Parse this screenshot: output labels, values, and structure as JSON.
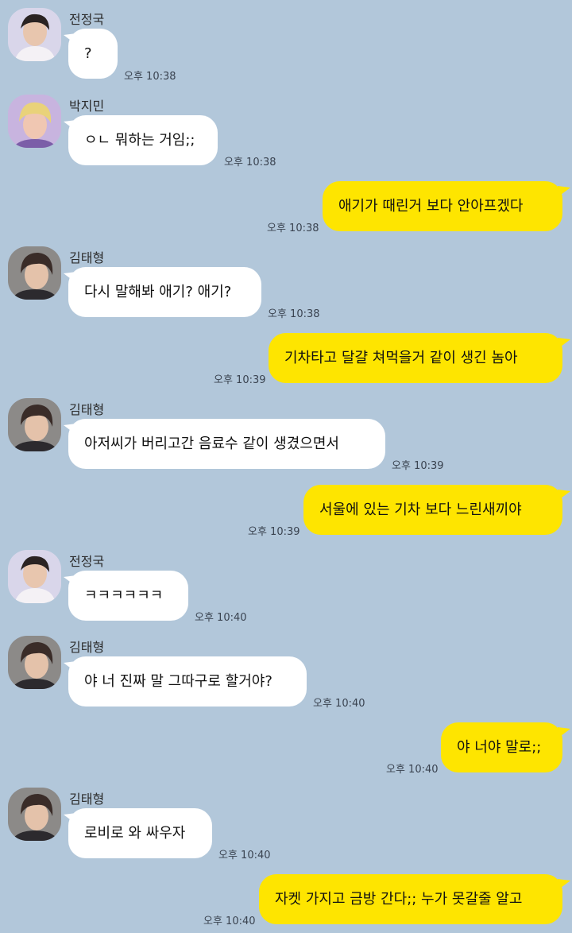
{
  "colors": {
    "background": "#b2c7da",
    "incoming_bubble": "#ffffff",
    "outgoing_bubble": "#fee500"
  },
  "messages": [
    {
      "type": "in",
      "sender": "전정국",
      "text": "?",
      "time": "오후 10:38",
      "avatar": "jungkook-avatar"
    },
    {
      "type": "in",
      "sender": "박지민",
      "text": "ㅇㄴ 뭐하는 거임;;",
      "time": "오후 10:38",
      "avatar": "jimin-avatar"
    },
    {
      "type": "out",
      "text": "애기가 때린거 보다 안아프겠다",
      "time": "오후 10:38"
    },
    {
      "type": "in",
      "sender": "김태형",
      "text": "다시 말해봐 애기? 애기?",
      "time": "오후 10:38",
      "avatar": "taehyung-avatar"
    },
    {
      "type": "out",
      "text": "기차타고 달걀 쳐먹을거 같이 생긴 놈아",
      "time": "오후 10:39"
    },
    {
      "type": "in",
      "sender": "김태형",
      "text": "아저씨가 버리고간 음료수 같이 생겼으면서",
      "time": "오후 10:39",
      "avatar": "taehyung-avatar"
    },
    {
      "type": "out",
      "text": "서울에 있는 기차 보다 느린새끼야",
      "time": "오후 10:39"
    },
    {
      "type": "in",
      "sender": "전정국",
      "text": "ㅋㅋㅋㅋㅋㅋ",
      "time": "오후 10:40",
      "avatar": "jungkook-avatar"
    },
    {
      "type": "in",
      "sender": "김태형",
      "text": "야 너 진짜 말 그따구로 할거야?",
      "time": "오후 10:40",
      "avatar": "taehyung-avatar"
    },
    {
      "type": "out",
      "text": "야 너야 말로;;",
      "time": "오후 10:40"
    },
    {
      "type": "in",
      "sender": "김태형",
      "text": "로비로 와 싸우자",
      "time": "오후 10:40",
      "avatar": "taehyung-avatar"
    },
    {
      "type": "out",
      "text": "자켓 가지고 금방 간다;; 누가 못갈줄 알고",
      "time": "오후 10:40"
    }
  ]
}
